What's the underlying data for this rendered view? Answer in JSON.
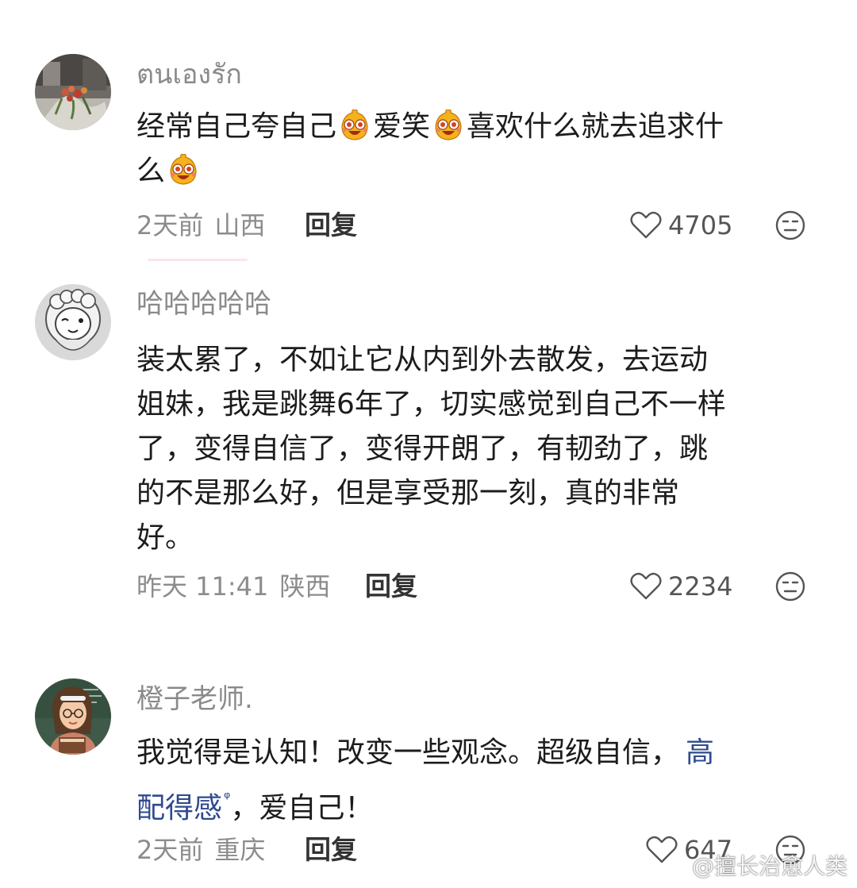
{
  "comments": [
    {
      "username": "ตนเองรัก",
      "segments": [
        "经常自己夸自己",
        "爱笑",
        "喜欢什么就去追求什",
        "么"
      ],
      "meta_time": "2天前",
      "meta_location": "山西",
      "reply_label": "回复",
      "likes": "4705",
      "avatar_icon": "flowers-avatar"
    },
    {
      "username": "哈哈哈哈哈",
      "lines": [
        "装太累了，不如让它从内到外去散发，去运动",
        "姐妹，我是跳舞6年了，切实感觉到自己不一样",
        "了，变得自信了，变得开朗了，有韧劲了，跳",
        "的不是那么好，但是享受那一刻，真的非常",
        "好。"
      ],
      "meta_time": "昨天 11:41",
      "meta_location": "陕西",
      "reply_label": "回复",
      "likes": "2234",
      "avatar_icon": "cartoon-sheep-avatar"
    },
    {
      "username": "橙子老师.",
      "line1": "我觉得是认知！改变一些观念。超级自信，",
      "link_part1": "高",
      "link_part2": "配得感",
      "line2_rest": "，爱自己！",
      "meta_time": "2天前",
      "meta_location": "重庆",
      "reply_label": "回复",
      "likes": "647",
      "avatar_icon": "teacher-avatar"
    }
  ],
  "emoji_name": "laughing-face-emoji",
  "search_mark": "ᵠ",
  "watermark": "@擅长治愈人类",
  "colors": {
    "username": "#8a8a8a",
    "meta": "#8c8c8c",
    "link": "#2f4a8f",
    "text": "#1c1c1c"
  }
}
